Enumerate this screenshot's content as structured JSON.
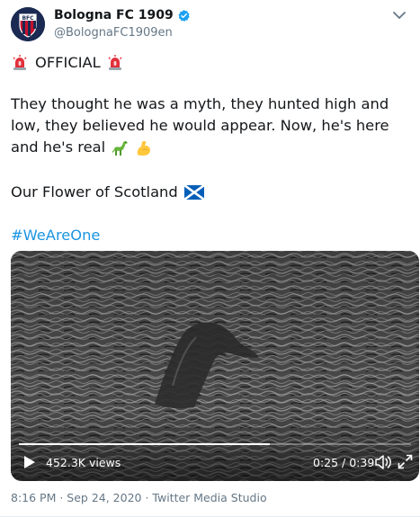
{
  "author": {
    "display_name": "Bologna FC 1909",
    "handle": "@BolognaFC1909en",
    "avatar_text": "BFC",
    "verified_icon": "verified-badge-icon"
  },
  "tweet": {
    "official_label": "OFFICIAL",
    "paragraph": "They thought he was a myth, they hunted high and low, they believed he would appear. Now, he's here and he's real",
    "scotland_line": "Our Flower of Scotland",
    "hashtag": "#WeAreOne",
    "emojis": [
      "police-light-icon",
      "sauropod-icon",
      "flexed-biceps-icon",
      "scotland-flag-icon"
    ]
  },
  "video": {
    "views": "452.3K views",
    "time": "0:25 / 0:39",
    "progress": 0.64,
    "play_icon": "play-icon",
    "volume_icon": "volume-icon",
    "expand_icon": "expand-icon"
  },
  "meta": {
    "timestamp_line": "8:16 PM · Sep 24, 2020 · Twitter Media Studio"
  },
  "colors": {
    "link": "#1b95e0",
    "verified": "#1da1f2",
    "muted": "#657786"
  }
}
